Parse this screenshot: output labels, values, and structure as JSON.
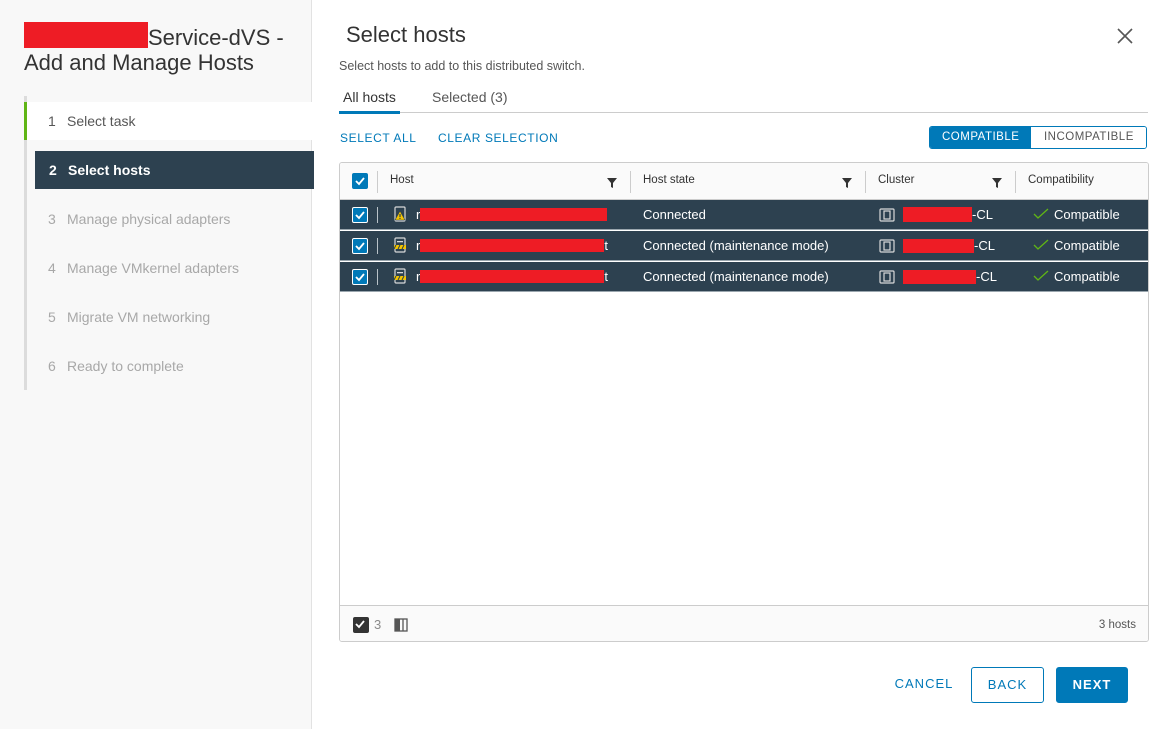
{
  "wizard": {
    "title_suffix": "Service-dVS -",
    "title_line2": "Add and Manage Hosts",
    "steps": [
      {
        "num": "1",
        "label": "Select task"
      },
      {
        "num": "2",
        "label": "Select hosts"
      },
      {
        "num": "3",
        "label": "Manage physical adapters"
      },
      {
        "num": "4",
        "label": "Manage VMkernel adapters"
      },
      {
        "num": "5",
        "label": "Migrate VM networking"
      },
      {
        "num": "6",
        "label": "Ready to complete"
      }
    ]
  },
  "main": {
    "title": "Select hosts",
    "subtitle": "Select hosts to add to this distributed switch.",
    "tabs": [
      {
        "label": "All hosts"
      },
      {
        "label": "Selected (3)"
      }
    ],
    "select_all": "SELECT ALL",
    "clear_selection": "CLEAR SELECTION",
    "toggle": {
      "compatible": "COMPATIBLE",
      "incompatible": "INCOMPATIBLE"
    }
  },
  "grid": {
    "columns": [
      "Host",
      "Host state",
      "Cluster",
      "Compatibility"
    ],
    "rows": [
      {
        "host_prefix": "r",
        "host_suffix": "",
        "state": "Connected",
        "cluster_prefix": "",
        "cluster_suffix": "-CL",
        "compatibility": "Compatible",
        "icon": "host-warning-icon"
      },
      {
        "host_prefix": "r",
        "host_suffix": "t",
        "state": "Connected (maintenance mode)",
        "cluster_prefix": "",
        "cluster_suffix": "-CL",
        "compatibility": "Compatible",
        "icon": "host-maintenance-icon"
      },
      {
        "host_prefix": "r",
        "host_suffix": "t",
        "state": "Connected (maintenance mode)",
        "cluster_prefix": "",
        "cluster_suffix": "-CL",
        "compatibility": "Compatible",
        "icon": "host-maintenance-icon"
      }
    ],
    "footer": {
      "selected_count": "3",
      "total": "3 hosts"
    }
  },
  "buttons": {
    "cancel": "CANCEL",
    "back": "BACK",
    "next": "NEXT"
  },
  "colors": {
    "accent": "#0079b8",
    "selected_row": "#2d4150",
    "redaction": "#ee1c25",
    "done_step": "#60b515"
  }
}
